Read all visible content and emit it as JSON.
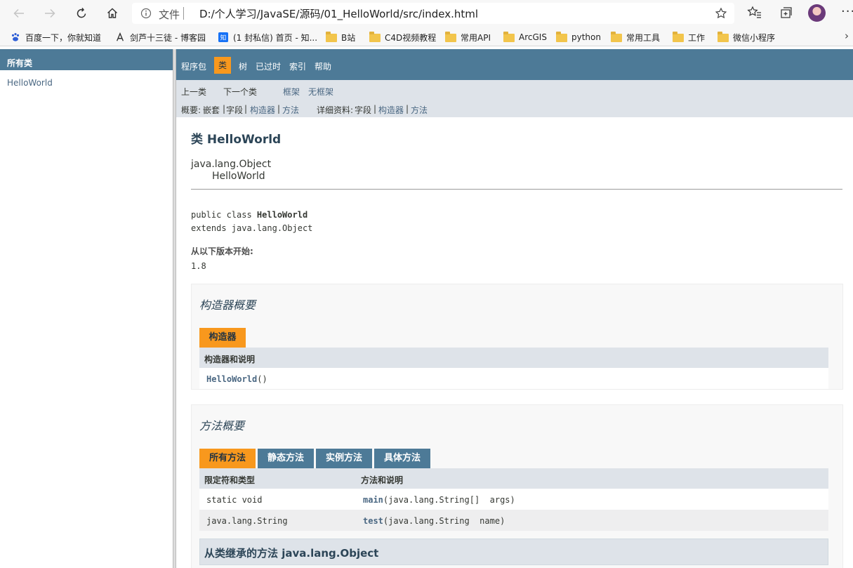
{
  "browser": {
    "address": {
      "scheme_label": "文件",
      "url": "D:/个人学习/JavaSE/源码/01_HelloWorld/src/index.html"
    },
    "more_label": "···",
    "bookmarks": [
      {
        "label": "百度一下，你就知道",
        "icon": "baidu-paw-icon"
      },
      {
        "label": "剑芦十三徒 - 博客园",
        "icon": "cnblogs-icon"
      },
      {
        "label": "(1 封私信) 首页 - 知...",
        "icon": "zhihu-icon"
      },
      {
        "label": "B站",
        "icon": "folder-icon"
      },
      {
        "label": "C4D视频教程",
        "icon": "folder-icon"
      },
      {
        "label": "常用API",
        "icon": "folder-icon"
      },
      {
        "label": "ArcGIS",
        "icon": "folder-icon"
      },
      {
        "label": "python",
        "icon": "folder-icon"
      },
      {
        "label": "常用工具",
        "icon": "folder-icon"
      },
      {
        "label": "工作",
        "icon": "folder-icon"
      },
      {
        "label": "微信小程序",
        "icon": "folder-icon"
      }
    ],
    "bookmarks_more": "›"
  },
  "left_frame": {
    "header": "所有类",
    "classes": [
      "HelloWorld"
    ]
  },
  "topnav": {
    "items": [
      "程序包",
      "类",
      "树",
      "已过时",
      "索引",
      "帮助"
    ]
  },
  "subnav": {
    "prev_class": "上一类",
    "next_class": "下一个类",
    "frames": "框架",
    "no_frames": "无框架",
    "summary_label": "概要:",
    "summary_nested": "嵌套",
    "summary_field": "字段",
    "summary_constr": "构造器",
    "summary_method": "方法",
    "detail_label": "详细资料:",
    "detail_field": "字段",
    "detail_constr": "构造器",
    "detail_method": "方法",
    "sep": "|"
  },
  "content": {
    "title": "类 HelloWorld",
    "inheritance_root": "java.lang.Object",
    "inheritance_child": "HelloWorld",
    "decl_prefix": "public class ",
    "decl_name": "HelloWorld",
    "decl_extends": "extends java.lang.Object",
    "since_label": "从以下版本开始:",
    "since_value": "1.8"
  },
  "constructor_summary": {
    "heading": "构造器概要",
    "tab": "构造器",
    "col_header": "构造器和说明",
    "rows": [
      {
        "name": "HelloWorld",
        "params": "()"
      }
    ]
  },
  "method_summary": {
    "heading": "方法概要",
    "tabs": [
      "所有方法",
      "静态方法",
      "实例方法",
      "具体方法"
    ],
    "col_modifier": "限定符和类型",
    "col_method": "方法和说明",
    "rows": [
      {
        "modifier": "static void",
        "name": "main",
        "params": "(java.lang.String[]  args)"
      },
      {
        "modifier": "java.lang.String",
        "name": "test",
        "params": "(java.lang.String  name)"
      }
    ],
    "inherited_heading": "从类继承的方法 java.lang.Object"
  }
}
